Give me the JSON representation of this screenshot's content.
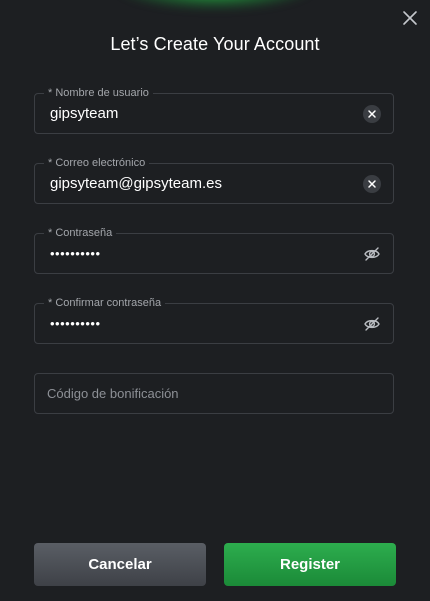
{
  "dialog": {
    "title": "Let’s Create Your Account",
    "close_icon": "close-icon"
  },
  "fields": {
    "username": {
      "label": "* Nombre de usuario",
      "value": "gipsyteam",
      "icon": "clear-icon"
    },
    "email": {
      "label": "* Correo electrónico",
      "value": "gipsyteam@gipsyteam.es",
      "icon": "clear-icon"
    },
    "password": {
      "label": "* Contraseña",
      "value": "••••••••••",
      "icon": "eye-off-icon"
    },
    "confirm_password": {
      "label": "* Confirmar contraseña",
      "value": "••••••••••",
      "icon": "eye-off-icon"
    },
    "bonus_code": {
      "placeholder": "Código de bonificación",
      "value": ""
    }
  },
  "buttons": {
    "cancel_label": "Cancelar",
    "register_label": "Register"
  },
  "colors": {
    "background": "#1d1f22",
    "field_border": "#3b3e43",
    "accent_green": "#22a045",
    "cancel_gray": "#4b4f55"
  }
}
